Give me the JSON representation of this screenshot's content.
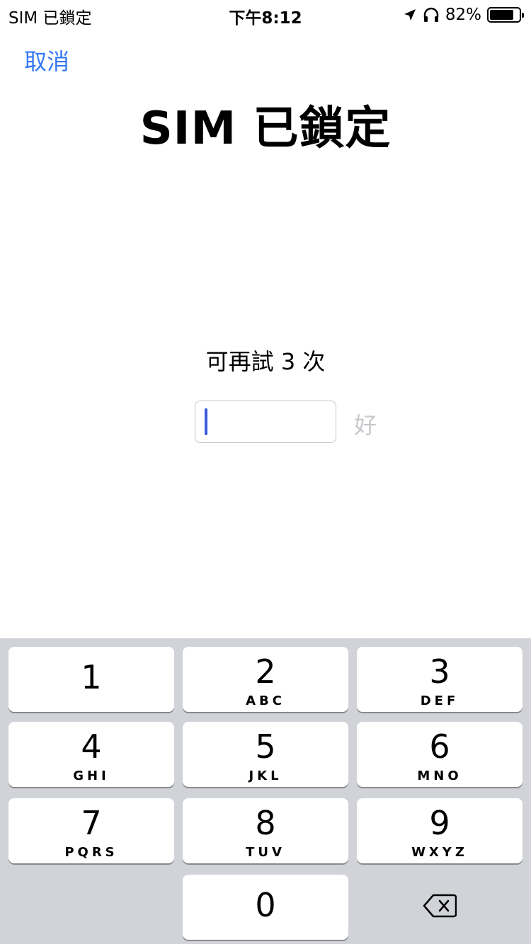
{
  "status_bar": {
    "carrier": "SIM 已鎖定",
    "time": "下午8:12",
    "battery_text": "82%",
    "battery_level": 0.82,
    "icons": [
      "location-arrow-icon",
      "headphones-icon",
      "battery-icon"
    ]
  },
  "nav": {
    "cancel_label": "取消"
  },
  "page": {
    "title": "SIM 已鎖定",
    "attempts_text": "可再試 3 次",
    "pin_value": "",
    "ok_label": "好"
  },
  "colors": {
    "accent": "#3478f6",
    "disabled": "#c7c7cc",
    "keypad_bg": "#d1d3d9",
    "caret": "#3a5bd9"
  },
  "keypad": {
    "keys": [
      {
        "digit": "1",
        "letters": ""
      },
      {
        "digit": "2",
        "letters": "ABC"
      },
      {
        "digit": "3",
        "letters": "DEF"
      },
      {
        "digit": "4",
        "letters": "GHI"
      },
      {
        "digit": "5",
        "letters": "JKL"
      },
      {
        "digit": "6",
        "letters": "MNO"
      },
      {
        "digit": "7",
        "letters": "PQRS"
      },
      {
        "digit": "8",
        "letters": "TUV"
      },
      {
        "digit": "9",
        "letters": "WXYZ"
      },
      {
        "digit": "0",
        "letters": ""
      }
    ],
    "delete_icon": "backspace-icon"
  }
}
